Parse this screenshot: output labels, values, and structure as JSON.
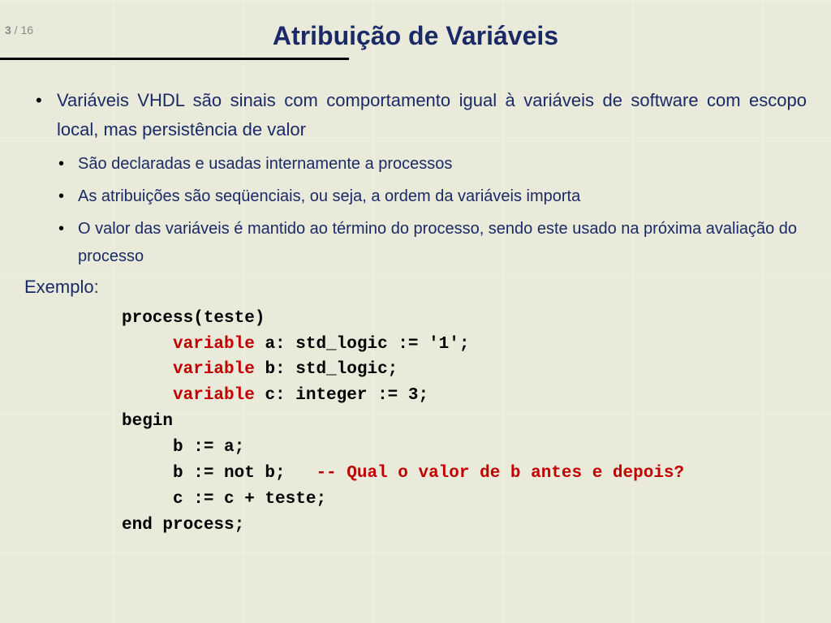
{
  "page": {
    "current": "3",
    "sep": " / ",
    "total": "16"
  },
  "title": "Atribuição de Variáveis",
  "bullets": {
    "main": "Variáveis VHDL são sinais com comportamento igual à variáveis de software com escopo local, mas persistência de valor",
    "sub1": "São declaradas e usadas internamente a processos",
    "sub2": "As atribuições são seqüenciais, ou seja, a ordem da variáveis importa",
    "sub3": "O valor das variáveis é mantido ao término do processo, sendo este usado na próxima avaliação do processo"
  },
  "example_label": "Exemplo:",
  "code": {
    "l1": "process(teste)",
    "kw": "variable",
    "l2a": " a: std_logic := '1';",
    "l3a": " b: std_logic;",
    "l4a": " c: integer := 3;",
    "l5": "begin",
    "l6": "     b := a;",
    "l7a": "     b := not b;   ",
    "l7c": "-- Qual o valor de b antes e depois?",
    "l8": "     c := c + teste;",
    "l9": "end process;"
  }
}
